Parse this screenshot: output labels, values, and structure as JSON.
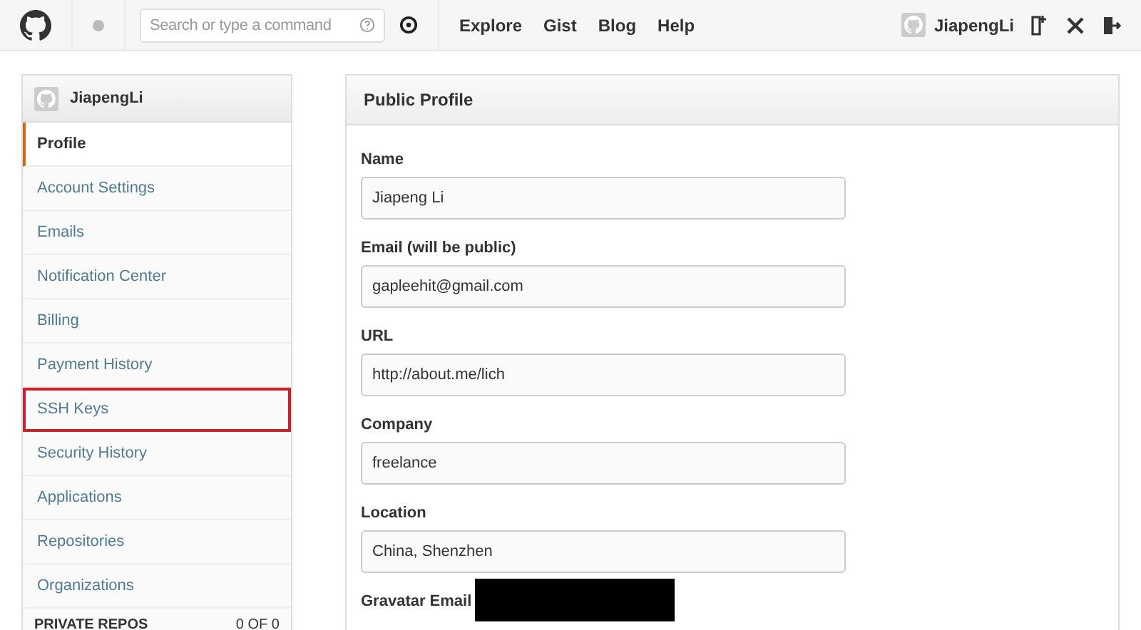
{
  "topbar": {
    "search": {
      "placeholder": "Search or type a command"
    },
    "nav": [
      "Explore",
      "Gist",
      "Blog",
      "Help"
    ],
    "user": "JiapengLi"
  },
  "sidebar": {
    "user": "JiapengLi",
    "items": [
      {
        "label": "Profile",
        "selected": true,
        "highlighted": false
      },
      {
        "label": "Account Settings",
        "selected": false,
        "highlighted": false
      },
      {
        "label": "Emails",
        "selected": false,
        "highlighted": false
      },
      {
        "label": "Notification Center",
        "selected": false,
        "highlighted": false
      },
      {
        "label": "Billing",
        "selected": false,
        "highlighted": false
      },
      {
        "label": "Payment History",
        "selected": false,
        "highlighted": false
      },
      {
        "label": "SSH Keys",
        "selected": false,
        "highlighted": true
      },
      {
        "label": "Security History",
        "selected": false,
        "highlighted": false
      },
      {
        "label": "Applications",
        "selected": false,
        "highlighted": false
      },
      {
        "label": "Repositories",
        "selected": false,
        "highlighted": false
      },
      {
        "label": "Organizations",
        "selected": false,
        "highlighted": false
      }
    ],
    "footer": {
      "label": "PRIVATE REPOS",
      "value": "0 OF 0"
    }
  },
  "main": {
    "title": "Public Profile",
    "fields": [
      {
        "label": "Name",
        "value": "Jiapeng Li"
      },
      {
        "label": "Email (will be public)",
        "value": "gapleehit@gmail.com"
      },
      {
        "label": "URL",
        "value": "http://about.me/lich"
      },
      {
        "label": "Company",
        "value": "freelance"
      },
      {
        "label": "Location",
        "value": "China, Shenzhen"
      },
      {
        "label": "Gravatar Email",
        "redacted": true
      }
    ]
  }
}
